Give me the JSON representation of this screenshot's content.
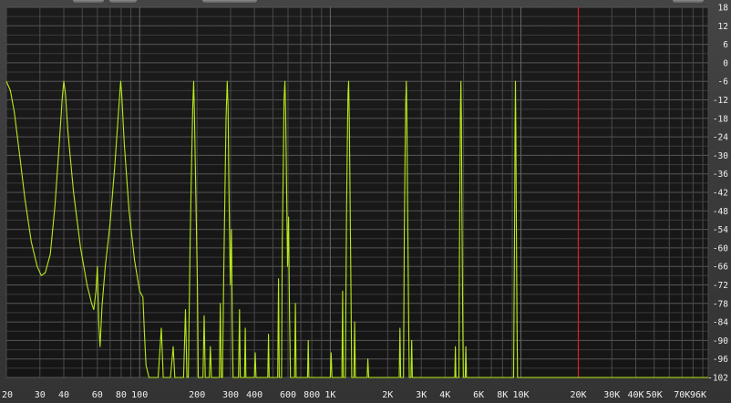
{
  "chart_data": {
    "type": "line",
    "xscale": "log",
    "xlim": [
      20,
      96000
    ],
    "ylim": [
      -102,
      18
    ],
    "x_ticks": [
      {
        "value": 20,
        "label": "20"
      },
      {
        "value": 30,
        "label": "30"
      },
      {
        "value": 40,
        "label": "40"
      },
      {
        "value": 60,
        "label": "60"
      },
      {
        "value": 80,
        "label": "80"
      },
      {
        "value": 100,
        "label": "100"
      },
      {
        "value": 200,
        "label": "200"
      },
      {
        "value": 300,
        "label": "300"
      },
      {
        "value": 400,
        "label": "400"
      },
      {
        "value": 600,
        "label": "600"
      },
      {
        "value": 800,
        "label": "800"
      },
      {
        "value": 1000,
        "label": "1K"
      },
      {
        "value": 2000,
        "label": "2K"
      },
      {
        "value": 3000,
        "label": "3K"
      },
      {
        "value": 4000,
        "label": "4K"
      },
      {
        "value": 6000,
        "label": "6K"
      },
      {
        "value": 8000,
        "label": "8K"
      },
      {
        "value": 10000,
        "label": "10K"
      },
      {
        "value": 20000,
        "label": "20K"
      },
      {
        "value": 30000,
        "label": "30K"
      },
      {
        "value": 40000,
        "label": "40K"
      },
      {
        "value": 50000,
        "label": "50K"
      },
      {
        "value": 70000,
        "label": "70K"
      },
      {
        "value": 96000,
        "label": "96K"
      }
    ],
    "y_ticks": [
      18,
      12,
      6,
      0,
      -6,
      -12,
      -18,
      -24,
      -30,
      -36,
      -42,
      -48,
      -54,
      -60,
      -66,
      -72,
      -78,
      -84,
      -90,
      -96,
      -102
    ],
    "grid": true,
    "marker_line": {
      "x": 20000,
      "color": "#e02020"
    },
    "series": [
      {
        "color": "#b8ea1a",
        "points": [
          [
            20,
            -6
          ],
          [
            21,
            -9
          ],
          [
            22,
            -16
          ],
          [
            23.5,
            -30
          ],
          [
            25,
            -44
          ],
          [
            27,
            -58
          ],
          [
            29,
            -66
          ],
          [
            30.5,
            -69
          ],
          [
            32,
            -68
          ],
          [
            34,
            -62
          ],
          [
            36,
            -46
          ],
          [
            38,
            -25
          ],
          [
            39.3,
            -11
          ],
          [
            40,
            -6
          ],
          [
            40.8,
            -10
          ],
          [
            42,
            -22
          ],
          [
            45,
            -42
          ],
          [
            49,
            -60
          ],
          [
            53,
            -72
          ],
          [
            56,
            -78
          ],
          [
            57.5,
            -80
          ],
          [
            59,
            -74
          ],
          [
            60,
            -66
          ],
          [
            61,
            -84
          ],
          [
            62,
            -92
          ],
          [
            63.5,
            -79
          ],
          [
            66,
            -66
          ],
          [
            70,
            -52
          ],
          [
            74,
            -34
          ],
          [
            77.5,
            -16
          ],
          [
            79.5,
            -6
          ],
          [
            80.5,
            -10
          ],
          [
            83,
            -26
          ],
          [
            88,
            -48
          ],
          [
            94,
            -64
          ],
          [
            100,
            -74
          ],
          [
            104,
            -76
          ],
          [
            106,
            -88
          ],
          [
            108,
            -98
          ],
          [
            112,
            -102
          ],
          [
            125,
            -102
          ],
          [
            130,
            -86
          ],
          [
            133,
            -102
          ],
          [
            145,
            -102
          ],
          [
            150,
            -92
          ],
          [
            153,
            -102
          ],
          [
            170,
            -102
          ],
          [
            174,
            -80
          ],
          [
            177,
            -102
          ],
          [
            180,
            -102
          ],
          [
            184,
            -58
          ],
          [
            187,
            -34
          ],
          [
            190,
            -14
          ],
          [
            192,
            -6
          ],
          [
            194,
            -18
          ],
          [
            197,
            -42
          ],
          [
            201,
            -72
          ],
          [
            203,
            -102
          ],
          [
            215,
            -102
          ],
          [
            218,
            -82
          ],
          [
            221,
            -102
          ],
          [
            232,
            -102
          ],
          [
            235,
            -92
          ],
          [
            238,
            -102
          ],
          [
            262,
            -102
          ],
          [
            265,
            -78
          ],
          [
            268,
            -102
          ],
          [
            272,
            -102
          ],
          [
            276,
            -70
          ],
          [
            280,
            -44
          ],
          [
            284,
            -18
          ],
          [
            288,
            -6
          ],
          [
            291,
            -14
          ],
          [
            294,
            -42
          ],
          [
            299,
            -72
          ],
          [
            303,
            -54
          ],
          [
            306,
            -84
          ],
          [
            309,
            -102
          ],
          [
            330,
            -102
          ],
          [
            334,
            -80
          ],
          [
            337,
            -102
          ],
          [
            355,
            -102
          ],
          [
            358,
            -86
          ],
          [
            361,
            -102
          ],
          [
            400,
            -102
          ],
          [
            404,
            -94
          ],
          [
            408,
            -102
          ],
          [
            470,
            -102
          ],
          [
            474,
            -88
          ],
          [
            478,
            -102
          ],
          [
            530,
            -102
          ],
          [
            535,
            -70
          ],
          [
            540,
            -102
          ],
          [
            555,
            -102
          ],
          [
            560,
            -58
          ],
          [
            566,
            -36
          ],
          [
            572,
            -12
          ],
          [
            578,
            -6
          ],
          [
            583,
            -16
          ],
          [
            590,
            -40
          ],
          [
            597,
            -66
          ],
          [
            604,
            -50
          ],
          [
            611,
            -80
          ],
          [
            618,
            -102
          ],
          [
            650,
            -102
          ],
          [
            656,
            -78
          ],
          [
            662,
            -102
          ],
          [
            760,
            -102
          ],
          [
            766,
            -90
          ],
          [
            772,
            -102
          ],
          [
            1000,
            -102
          ],
          [
            1010,
            -94
          ],
          [
            1020,
            -102
          ],
          [
            1150,
            -102
          ],
          [
            1160,
            -74
          ],
          [
            1170,
            -102
          ],
          [
            1200,
            -102
          ],
          [
            1215,
            -52
          ],
          [
            1228,
            -28
          ],
          [
            1238,
            -10
          ],
          [
            1248,
            -6
          ],
          [
            1258,
            -18
          ],
          [
            1270,
            -44
          ],
          [
            1283,
            -72
          ],
          [
            1296,
            -102
          ],
          [
            1330,
            -102
          ],
          [
            1342,
            -84
          ],
          [
            1354,
            -102
          ],
          [
            1560,
            -102
          ],
          [
            1575,
            -96
          ],
          [
            1590,
            -102
          ],
          [
            2300,
            -102
          ],
          [
            2320,
            -86
          ],
          [
            2340,
            -102
          ],
          [
            2420,
            -102
          ],
          [
            2445,
            -54
          ],
          [
            2468,
            -30
          ],
          [
            2488,
            -12
          ],
          [
            2505,
            -6
          ],
          [
            2522,
            -18
          ],
          [
            2545,
            -46
          ],
          [
            2570,
            -76
          ],
          [
            2595,
            -102
          ],
          [
            2650,
            -102
          ],
          [
            2672,
            -90
          ],
          [
            2695,
            -102
          ],
          [
            4500,
            -102
          ],
          [
            4530,
            -92
          ],
          [
            4560,
            -102
          ],
          [
            4730,
            -102
          ],
          [
            4760,
            -62
          ],
          [
            4790,
            -34
          ],
          [
            4820,
            -14
          ],
          [
            4845,
            -6
          ],
          [
            4870,
            -18
          ],
          [
            4905,
            -48
          ],
          [
            4945,
            -80
          ],
          [
            4985,
            -102
          ],
          [
            5100,
            -102
          ],
          [
            5140,
            -92
          ],
          [
            5180,
            -102
          ],
          [
            9150,
            -102
          ],
          [
            9210,
            -74
          ],
          [
            9270,
            -46
          ],
          [
            9320,
            -20
          ],
          [
            9360,
            -6
          ],
          [
            9400,
            -20
          ],
          [
            9460,
            -52
          ],
          [
            9530,
            -84
          ],
          [
            9600,
            -102
          ],
          [
            96000,
            -102
          ]
        ]
      }
    ]
  }
}
